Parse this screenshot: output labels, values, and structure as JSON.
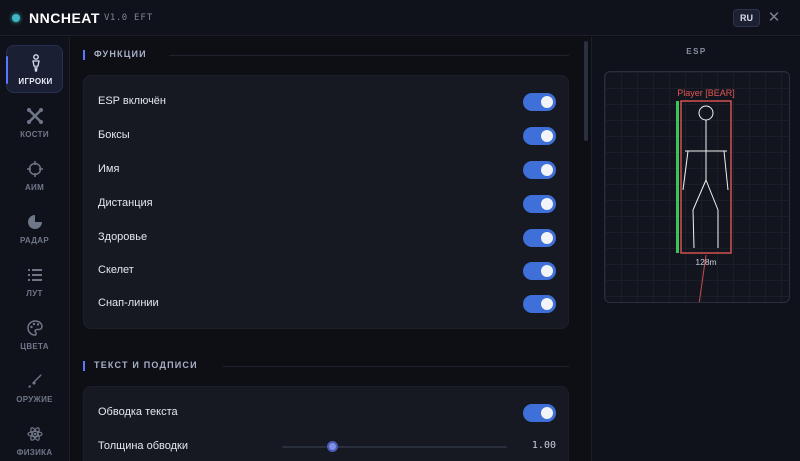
{
  "app": {
    "title": "NNCHEAT",
    "version": "V1.0",
    "game": "EFT",
    "language": "RU"
  },
  "sidebar": {
    "items": [
      {
        "label": "ИГРОКИ",
        "icon": "player-icon",
        "active": true
      },
      {
        "label": "КОСТИ",
        "icon": "bones-icon",
        "active": false
      },
      {
        "label": "АИМ",
        "icon": "crosshair-icon",
        "active": false
      },
      {
        "label": "РАДАР",
        "icon": "radar-icon",
        "active": false
      },
      {
        "label": "ЛУТ",
        "icon": "list-icon",
        "active": false
      },
      {
        "label": "ЦВЕТА",
        "icon": "palette-icon",
        "active": false
      },
      {
        "label": "ОРУЖИЕ",
        "icon": "weapon-icon",
        "active": false
      },
      {
        "label": "ФИЗИКА",
        "icon": "physics-icon",
        "active": false
      }
    ]
  },
  "sections": {
    "functions": {
      "title": "ФУНКЦИИ",
      "toggles": [
        {
          "label": "ESP включён",
          "on": true
        },
        {
          "label": "Боксы",
          "on": true
        },
        {
          "label": "Имя",
          "on": true
        },
        {
          "label": "Дистанция",
          "on": true
        },
        {
          "label": "Здоровье",
          "on": true
        },
        {
          "label": "Скелет",
          "on": true
        },
        {
          "label": "Снап-линии",
          "on": true
        }
      ]
    },
    "text": {
      "title": "ТЕКСТ И ПОДПИСИ",
      "outline_toggle": {
        "label": "Обводка текста",
        "on": true
      },
      "outline_thickness": {
        "label": "Толщина обводки",
        "value": "1.00",
        "fraction": 0.22
      }
    }
  },
  "preview": {
    "title": "ESP",
    "player_name": "Player [BEAR]",
    "distance": "128m",
    "health_fraction": 1.0
  },
  "colors": {
    "accent": "#5a78ff",
    "toggle_on": "#3f6fd8",
    "box": "#e05555",
    "health": "#3fc25a",
    "skeleton": "#f2f2f2"
  }
}
